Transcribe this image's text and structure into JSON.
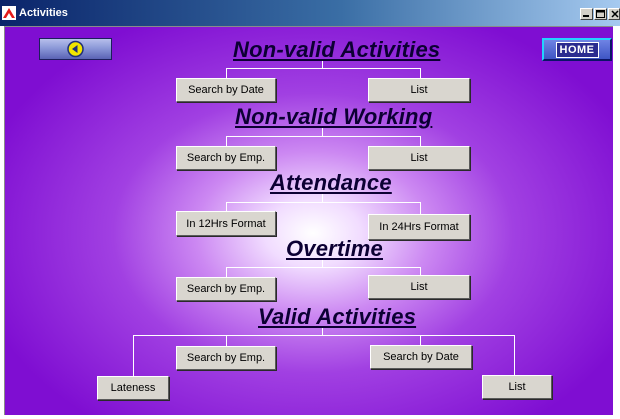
{
  "window": {
    "title": "Activities",
    "icon": "red-house-icon",
    "controls": [
      "minimize-icon",
      "maximize-icon",
      "close-icon"
    ]
  },
  "colors": {
    "background_center": "#ffffff",
    "background_edge": "#7f0ed2",
    "heading_text": "#0c0033",
    "button_face": "#d9d6cf",
    "connector_lines": "#ffffff",
    "home_button": "#3e55c4"
  },
  "nav": {
    "back_icon": "back-arrow-icon",
    "home_label": "HOME"
  },
  "sections": {
    "non_valid_activities": {
      "title": "Non-valid Activities",
      "buttons": [
        "Search by Date",
        "List"
      ]
    },
    "non_valid_working": {
      "title": "Non-valid Working",
      "buttons": [
        "Search by Emp.",
        "List"
      ]
    },
    "attendance": {
      "title": "Attendance",
      "buttons": [
        "In 12Hrs Format",
        "In 24Hrs Format"
      ]
    },
    "overtime": {
      "title": "Overtime",
      "buttons": [
        "Search by Emp.",
        "List"
      ]
    },
    "valid_activities": {
      "title": "Valid Activities",
      "buttons": [
        "Lateness",
        "Search by Emp.",
        "Search by Date",
        "List"
      ]
    }
  }
}
